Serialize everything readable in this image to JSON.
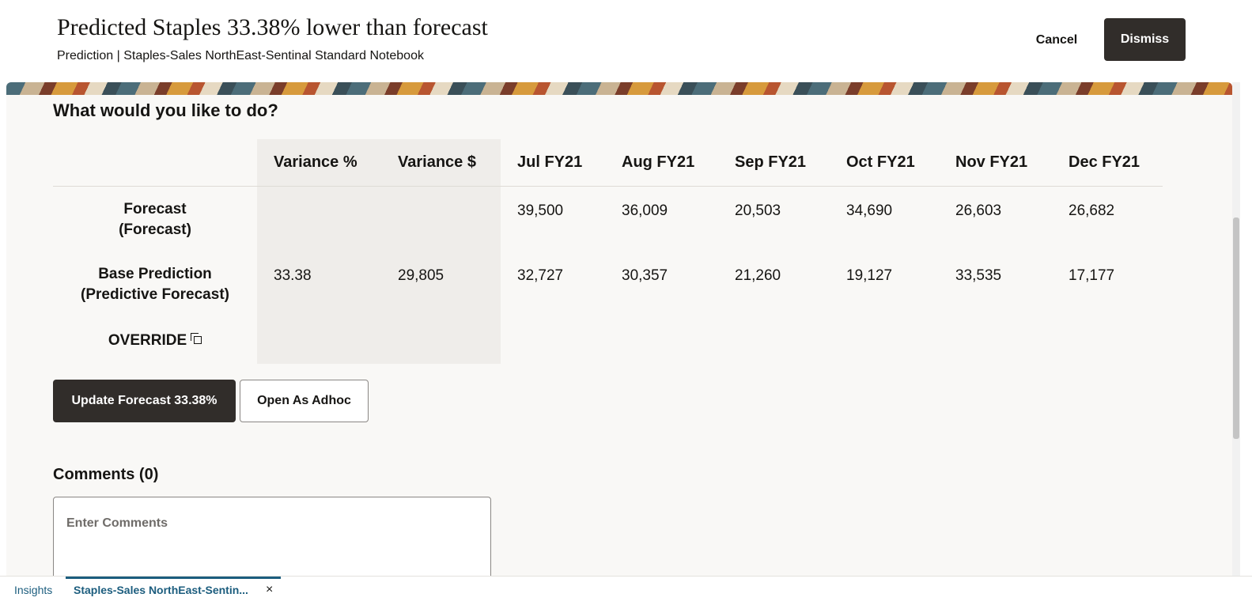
{
  "header": {
    "title": "Predicted Staples 33.38% lower than forecast",
    "subtitle": "Prediction | Staples-Sales NorthEast-Sentinal Standard Notebook",
    "cancel_label": "Cancel",
    "dismiss_label": "Dismiss"
  },
  "panel": {
    "question": "What would you like to do?",
    "columns": [
      "Variance %",
      "Variance $",
      "Jul FY21",
      "Aug FY21",
      "Sep FY21",
      "Oct FY21",
      "Nov FY21",
      "Dec FY21"
    ],
    "rows": [
      {
        "label_line1": "Forecast",
        "label_line2": "(Forecast)",
        "values": [
          "",
          "",
          "39,500",
          "36,009",
          "20,503",
          "34,690",
          "26,603",
          "26,682"
        ]
      },
      {
        "label_line1": "Base Prediction",
        "label_line2": "(Predictive Forecast)",
        "values": [
          "33.38",
          "29,805",
          "32,727",
          "30,357",
          "21,260",
          "19,127",
          "33,535",
          "17,177"
        ]
      },
      {
        "label_line1": "OVERRIDE",
        "label_line2": "",
        "icon": "copy-icon",
        "values": [
          "",
          "",
          "",
          "",
          "",
          "",
          "",
          ""
        ]
      }
    ],
    "update_label": "Update Forecast 33.38%",
    "adhoc_label": "Open As Adhoc",
    "comments_title": "Comments (0)",
    "comments_placeholder": "Enter Comments"
  },
  "bottom_tabs": {
    "insights_label": "Insights",
    "active_label": "Staples-Sales NorthEast-Sentin...",
    "close_glyph": "×"
  },
  "colors": {
    "primary_button": "#312d2a",
    "panel_bg": "#f9f8f6",
    "tab_accent": "#1c5d7e"
  }
}
